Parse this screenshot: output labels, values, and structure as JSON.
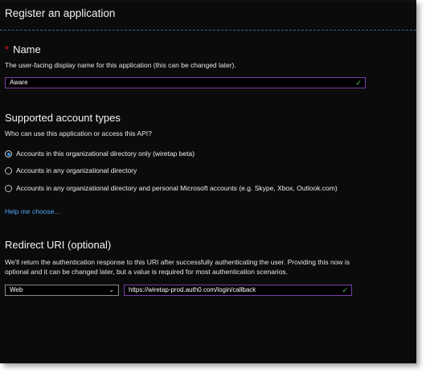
{
  "header": {
    "title": "Register an application"
  },
  "name_section": {
    "required_mark": "*",
    "title": "Name",
    "description": "The user-facing display name for this application (this can be changed later).",
    "value": "Aware"
  },
  "account_types": {
    "title": "Supported account types",
    "question": "Who can use this application or access this API?",
    "options": [
      {
        "label": "Accounts in this organizational directory only (wiretap beta)",
        "selected": true
      },
      {
        "label": "Accounts in any organizational directory",
        "selected": false
      },
      {
        "label": "Accounts in any organizational directory and personal Microsoft accounts (e.g. Skype, Xbox, Outlook.com)",
        "selected": false
      }
    ],
    "help_link": "Help me choose..."
  },
  "redirect": {
    "title": "Redirect URI (optional)",
    "description_line1": "We'll return the authentication response to this URI after successfully authenticating the user. Providing this now is",
    "description_line2": "optional and it can be changed later, but a value is required for most authentication scenarios.",
    "platform": "Web",
    "uri": "https://wiretap-prod.auth0.com/login/callback"
  },
  "icons": {
    "valid_check": "checkmark-icon",
    "dropdown": "chevron-down-icon",
    "accent_color": "#7a3fa5",
    "link_color": "#4ea4f5",
    "valid_color": "#4fcf4f"
  }
}
